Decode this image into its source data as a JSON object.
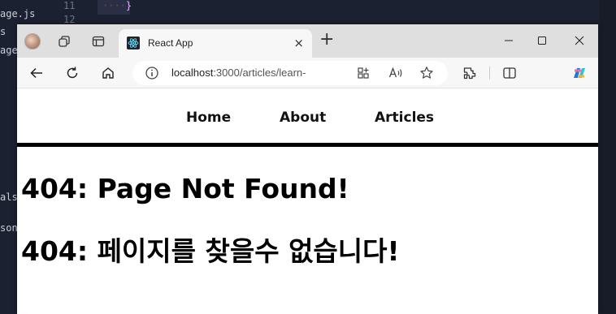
{
  "editor": {
    "side_fragments": [
      "age.js",
      "s",
      "age",
      "als.",
      "son"
    ],
    "line_numbers": [
      "11",
      "12"
    ],
    "code_snippet": "}"
  },
  "browser": {
    "tab": {
      "title": "React App",
      "close": "×"
    },
    "new_tab": "+",
    "address": {
      "host": "localhost",
      "path": ":3000/articles/learn-"
    }
  },
  "page": {
    "nav": {
      "home": "Home",
      "about": "About",
      "articles": "Articles"
    },
    "heading_en": "404: Page Not Found!",
    "heading_ko": "404: 페이지를 찾을수 없습니다!"
  },
  "colors": {
    "nav_border": "#000000",
    "tabbar": "#dfdfdf",
    "editor_bg": "#1b2130"
  }
}
